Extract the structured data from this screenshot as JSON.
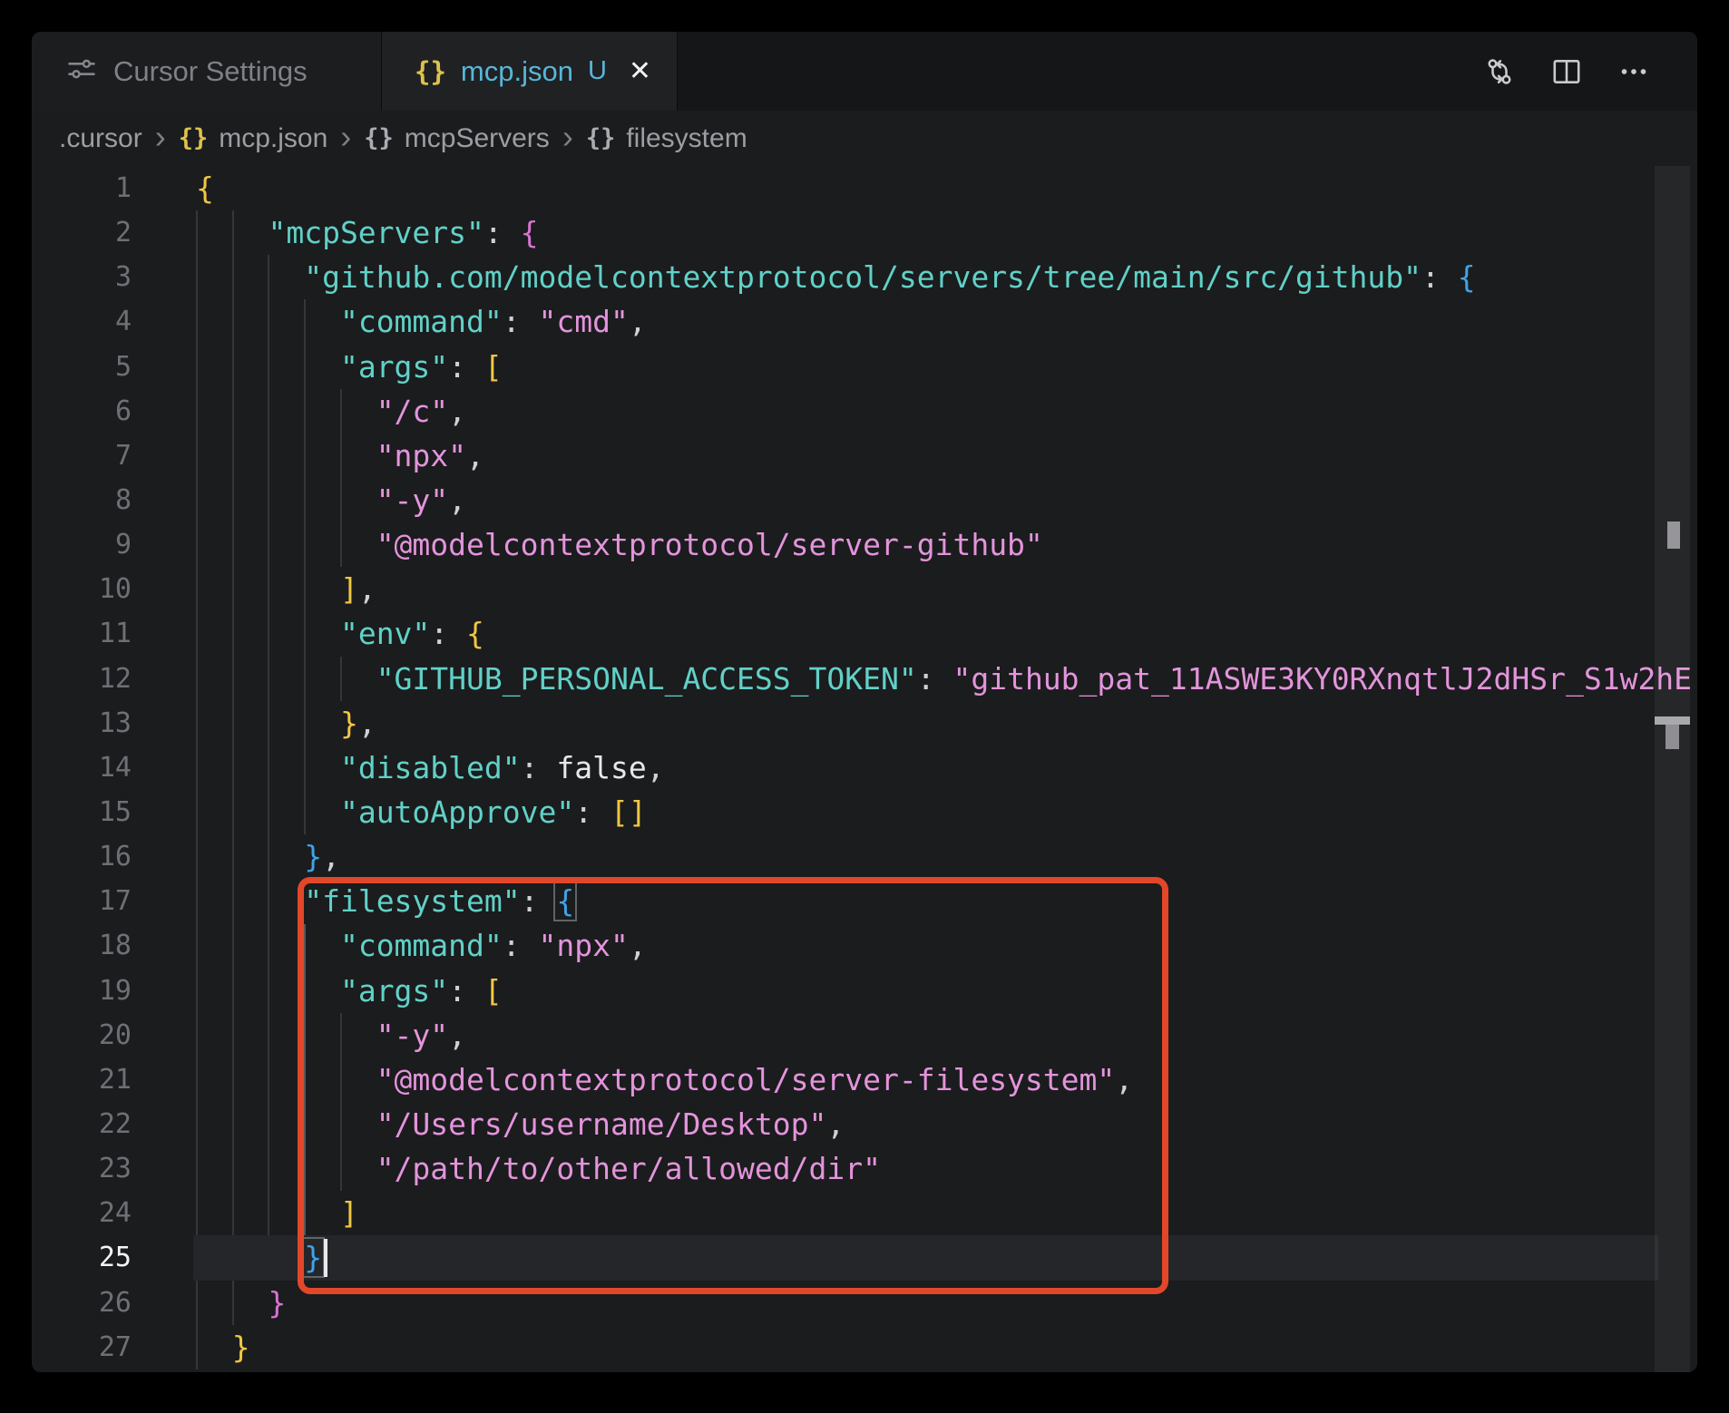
{
  "tabs": {
    "inactive": {
      "label": "Cursor Settings"
    },
    "active": {
      "label": "mcp.json",
      "badge": "U"
    }
  },
  "icons": {
    "braces": "{}",
    "close": "✕",
    "chevron": "›"
  },
  "breadcrumb": {
    "items": [
      ".cursor",
      "mcp.json",
      "mcpServers",
      "filesystem"
    ]
  },
  "editor": {
    "colors": {
      "key": "#61d1c8",
      "str": "#e394dc",
      "pun": "#ced1d6",
      "kw": "#e6e9ec",
      "b1": "#f0c644",
      "b2": "#d873d1",
      "b3": "#3fa3ea",
      "lineno": "#6d7076",
      "lineno-active": "#f5f5f5",
      "red": "#e2472a",
      "tabblue": "#58b6d8",
      "yellow": "#ddc24c"
    },
    "guides": [
      {
        "col": 0,
        "from": 2,
        "to": 27
      },
      {
        "col": 2,
        "from": 2,
        "to": 26
      },
      {
        "col": 4,
        "from": 3,
        "to": 25
      },
      {
        "col": 6,
        "from": 4,
        "to": 15
      },
      {
        "col": 6,
        "from": 18,
        "to": 24,
        "active": true
      },
      {
        "col": 8,
        "from": 6,
        "to": 9
      },
      {
        "col": 8,
        "from": 12,
        "to": 12
      },
      {
        "col": 8,
        "from": 20,
        "to": 23
      }
    ],
    "lines": [
      {
        "n": 1,
        "indent": 0,
        "tokens": [
          [
            "b1",
            "{"
          ]
        ]
      },
      {
        "n": 2,
        "indent": 4,
        "tokens": [
          [
            "key",
            "\"mcpServers\""
          ],
          [
            "pun",
            ": "
          ],
          [
            "b2",
            "{"
          ]
        ]
      },
      {
        "n": 3,
        "indent": 6,
        "tokens": [
          [
            "key",
            "\"github.com/modelcontextprotocol/servers/tree/main/src/github\""
          ],
          [
            "pun",
            ": "
          ],
          [
            "b3",
            "{"
          ]
        ]
      },
      {
        "n": 4,
        "indent": 8,
        "tokens": [
          [
            "key",
            "\"command\""
          ],
          [
            "pun",
            ": "
          ],
          [
            "str",
            "\"cmd\""
          ],
          [
            "pun",
            ","
          ]
        ]
      },
      {
        "n": 5,
        "indent": 8,
        "tokens": [
          [
            "key",
            "\"args\""
          ],
          [
            "pun",
            ": "
          ],
          [
            "b1",
            "["
          ]
        ]
      },
      {
        "n": 6,
        "indent": 10,
        "tokens": [
          [
            "str",
            "\"/c\""
          ],
          [
            "pun",
            ","
          ]
        ]
      },
      {
        "n": 7,
        "indent": 10,
        "tokens": [
          [
            "str",
            "\"npx\""
          ],
          [
            "pun",
            ","
          ]
        ]
      },
      {
        "n": 8,
        "indent": 10,
        "tokens": [
          [
            "str",
            "\"-y\""
          ],
          [
            "pun",
            ","
          ]
        ]
      },
      {
        "n": 9,
        "indent": 10,
        "tokens": [
          [
            "str",
            "\"@modelcontextprotocol/server-github\""
          ]
        ]
      },
      {
        "n": 10,
        "indent": 8,
        "tokens": [
          [
            "b1",
            "]"
          ],
          [
            "pun",
            ","
          ]
        ]
      },
      {
        "n": 11,
        "indent": 8,
        "tokens": [
          [
            "key",
            "\"env\""
          ],
          [
            "pun",
            ": "
          ],
          [
            "b1",
            "{"
          ]
        ]
      },
      {
        "n": 12,
        "indent": 10,
        "tokens": [
          [
            "key",
            "\"GITHUB_PERSONAL_ACCESS_TOKEN\""
          ],
          [
            "pun",
            ": "
          ],
          [
            "str",
            "\"github_pat_11ASWE3KY0RXnqtlJ2dHSr_S1w2hE"
          ]
        ]
      },
      {
        "n": 13,
        "indent": 8,
        "tokens": [
          [
            "b1",
            "}"
          ],
          [
            "pun",
            ","
          ]
        ]
      },
      {
        "n": 14,
        "indent": 8,
        "tokens": [
          [
            "key",
            "\"disabled\""
          ],
          [
            "pun",
            ": "
          ],
          [
            "kw",
            "false"
          ],
          [
            "pun",
            ","
          ]
        ]
      },
      {
        "n": 15,
        "indent": 8,
        "tokens": [
          [
            "key",
            "\"autoApprove\""
          ],
          [
            "pun",
            ": "
          ],
          [
            "b1",
            "[]"
          ]
        ]
      },
      {
        "n": 16,
        "indent": 6,
        "tokens": [
          [
            "b3",
            "}"
          ],
          [
            "pun",
            ","
          ]
        ]
      },
      {
        "n": 17,
        "indent": 6,
        "tokens": [
          [
            "key",
            "\"filesystem\""
          ],
          [
            "pun",
            ": "
          ],
          [
            "b3m",
            "{"
          ]
        ]
      },
      {
        "n": 18,
        "indent": 8,
        "tokens": [
          [
            "key",
            "\"command\""
          ],
          [
            "pun",
            ": "
          ],
          [
            "str",
            "\"npx\""
          ],
          [
            "pun",
            ","
          ]
        ]
      },
      {
        "n": 19,
        "indent": 8,
        "tokens": [
          [
            "key",
            "\"args\""
          ],
          [
            "pun",
            ": "
          ],
          [
            "b1",
            "["
          ]
        ]
      },
      {
        "n": 20,
        "indent": 10,
        "tokens": [
          [
            "str",
            "\"-y\""
          ],
          [
            "pun",
            ","
          ]
        ]
      },
      {
        "n": 21,
        "indent": 10,
        "tokens": [
          [
            "str",
            "\"@modelcontextprotocol/server-filesystem\""
          ],
          [
            "pun",
            ","
          ]
        ]
      },
      {
        "n": 22,
        "indent": 10,
        "tokens": [
          [
            "str",
            "\"/Users/username/Desktop\""
          ],
          [
            "pun",
            ","
          ]
        ]
      },
      {
        "n": 23,
        "indent": 10,
        "tokens": [
          [
            "str",
            "\"/path/to/other/allowed/dir\""
          ]
        ]
      },
      {
        "n": 24,
        "indent": 8,
        "tokens": [
          [
            "b1",
            "]"
          ]
        ]
      },
      {
        "n": 25,
        "indent": 6,
        "current": true,
        "tokens": [
          [
            "b3m",
            "}"
          ]
        ]
      },
      {
        "n": 26,
        "indent": 4,
        "tokens": [
          [
            "b2",
            "}"
          ]
        ]
      },
      {
        "n": 27,
        "indent": 2,
        "tokens": [
          [
            "b1",
            "}"
          ]
        ]
      }
    ]
  }
}
